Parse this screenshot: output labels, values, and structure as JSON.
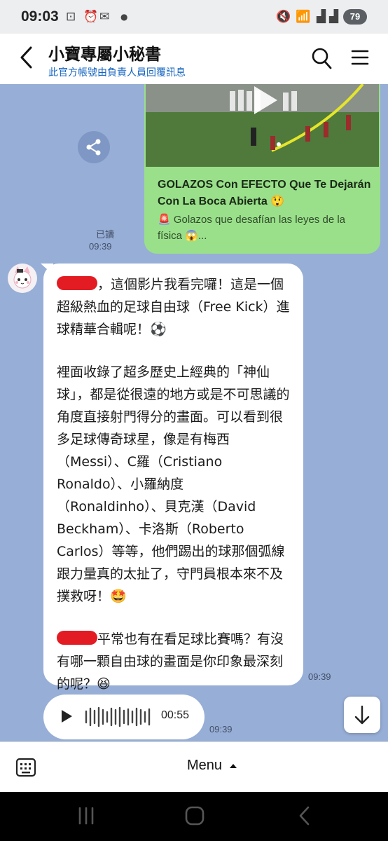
{
  "status_bar": {
    "time": "09:03",
    "battery": "79"
  },
  "header": {
    "title": "小寶專屬小秘書",
    "subtitle": "此官方帳號由負責人員回覆訊息"
  },
  "video_card": {
    "title": "GOLAZOS Con EFECTO Que Te Dejarán Con La Boca Abierta 😲",
    "description": "🚨 Golazos que desafían las leyes de la física 😱..."
  },
  "sent_meta": {
    "read": "已讀",
    "time": "09:39"
  },
  "reply": {
    "p1": "，這個影片我看完囉！這是一個超級熱血的足球自由球（Free Kick）進球精華合輯呢！⚽",
    "p2": "裡面收錄了超多歷史上經典的「神仙球」，都是從很遠的地方或是不可思議的角度直接射門得分的畫面。可以看到很多足球傳奇球星，像是有梅西（Messi）、C羅（Cristiano Ronaldo）、小羅納度（Ronaldinho）、貝克漢（David Beckham）、卡洛斯（Roberto Carlos）等等，他們踢出的球那個弧線跟力量真的太扯了，守門員根本來不及撲救呀！🤩",
    "p3": "平常也有在看足球比賽嗎？有沒有哪一顆自由球的畫面是你印象最深刻的呢？😆",
    "time": "09:39"
  },
  "voice": {
    "duration": "00:55",
    "time": "09:39"
  },
  "bottom_bar": {
    "menu_label": "Menu"
  }
}
